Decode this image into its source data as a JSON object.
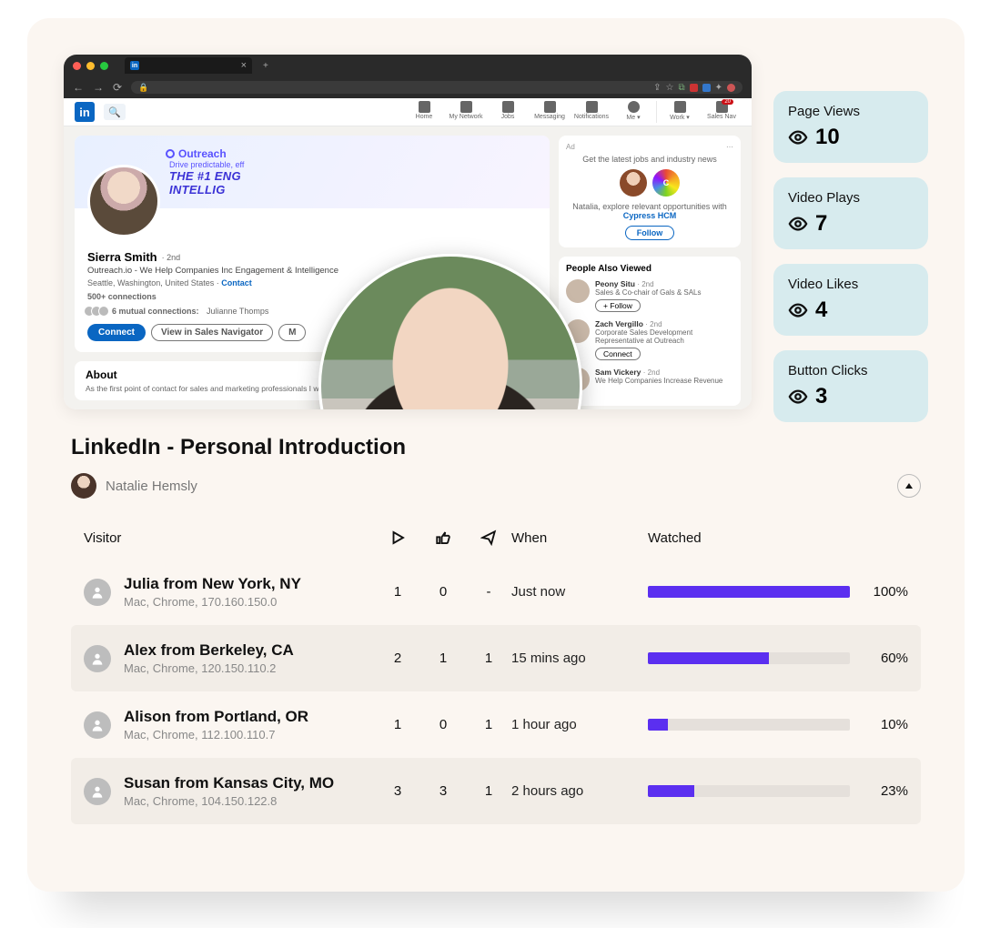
{
  "browser": {
    "tab_title": "",
    "nav": [
      {
        "label": "Home"
      },
      {
        "label": "My Network"
      },
      {
        "label": "Jobs"
      },
      {
        "label": "Messaging"
      },
      {
        "label": "Notifications"
      },
      {
        "label": "Me ▾",
        "round": true
      },
      {
        "label": "Work ▾"
      },
      {
        "label": "Sales Nav",
        "badge": "20"
      }
    ]
  },
  "profile": {
    "brand": "Outreach",
    "tagline_small": "Drive predictable, eff",
    "tagline_big": "THE #1 ENG\nINTELLIG",
    "name": "Sierra Smith",
    "degree": "· 2nd",
    "subtitle": "Outreach.io - We Help Companies Inc Engagement & Intelligence",
    "location": "Seattle, Washington, United States ·",
    "contact": "Contact",
    "connections": "500+ connections",
    "mutual": "6 mutual connections:",
    "mutual_tail": "Julianne Thomps",
    "btn_connect": "Connect",
    "btn_view": "View in Sales Navigator",
    "btn_more": "M",
    "about_h": "About",
    "about_p": "As the first point of contact for sales and marketing professionals  I work hard to help assist them in order to drive"
  },
  "ad": {
    "label": "Ad",
    "head": "Get the latest jobs and industry news",
    "body1": "Natalia, explore relevant opportunities with ",
    "body2": "Cypress HCM",
    "follow": "Follow"
  },
  "pav": {
    "title": "People Also Viewed",
    "rows": [
      {
        "name": "Peony Situ",
        "deg": "· 2nd",
        "role": "Sales & Co-chair of Gals & SALs",
        "btn": "+ Follow"
      },
      {
        "name": "Zach Vergillo",
        "deg": "· 2nd",
        "role": "Corporate Sales Development Representative at Outreach",
        "btn": "Connect"
      },
      {
        "name": "Sam Vickery",
        "deg": "· 2nd",
        "role": "We Help Companies Increase Revenue",
        "btn": ""
      }
    ]
  },
  "stats": [
    {
      "label": "Page Views",
      "value": "10"
    },
    {
      "label": "Video Plays",
      "value": "7"
    },
    {
      "label": "Video Likes",
      "value": "4"
    },
    {
      "label": "Button Clicks",
      "value": "3"
    }
  ],
  "page_title": "LinkedIn - Personal Introduction",
  "author": "Natalie Hemsly",
  "table": {
    "headers": {
      "visitor": "Visitor",
      "when": "When",
      "watched": "Watched"
    },
    "rows": [
      {
        "name": "Julia from New York, NY",
        "meta": "Mac, Chrome, 170.160.150.0",
        "plays": "1",
        "likes": "0",
        "clicks": "-",
        "when": "Just now",
        "pct": 100
      },
      {
        "name": "Alex from Berkeley, CA",
        "meta": "Mac, Chrome, 120.150.110.2",
        "plays": "2",
        "likes": "1",
        "clicks": "1",
        "when": "15 mins ago",
        "pct": 60
      },
      {
        "name": "Alison from Portland, OR",
        "meta": "Mac, Chrome, 112.100.110.7",
        "plays": "1",
        "likes": "0",
        "clicks": "1",
        "when": "1 hour ago",
        "pct": 10
      },
      {
        "name": "Susan from Kansas City, MO",
        "meta": "Mac, Chrome, 104.150.122.8",
        "plays": "3",
        "likes": "3",
        "clicks": "1",
        "when": "2 hours ago",
        "pct": 23
      }
    ]
  }
}
